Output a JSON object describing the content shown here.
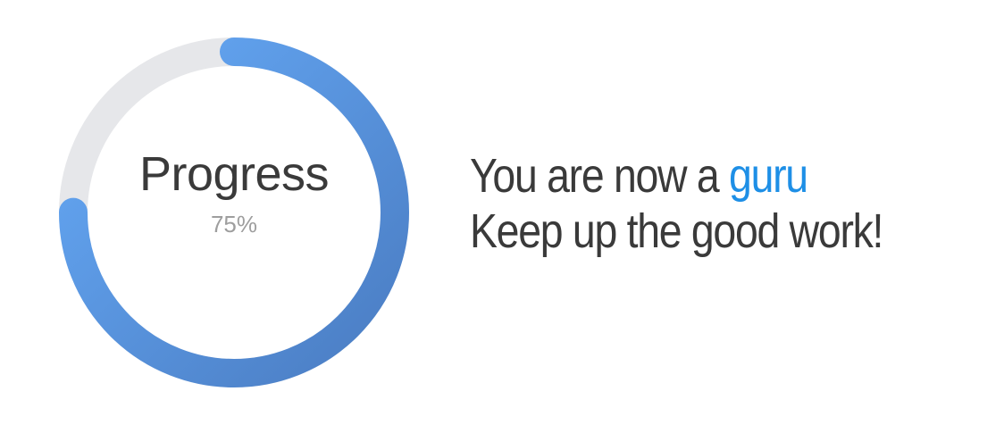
{
  "progress": {
    "title": "Progress",
    "value_text": "75%",
    "fraction": 0.75,
    "colors": {
      "track": "#e6e7ea",
      "gradient_start": "#4a7cc2",
      "gradient_end": "#66aaf7"
    }
  },
  "message": {
    "line1_prefix": "You are now a ",
    "line1_highlight": "guru",
    "line2": "Keep up the good work!",
    "highlight_color": "#1e8fe6",
    "text_color": "#3a3a3a"
  }
}
